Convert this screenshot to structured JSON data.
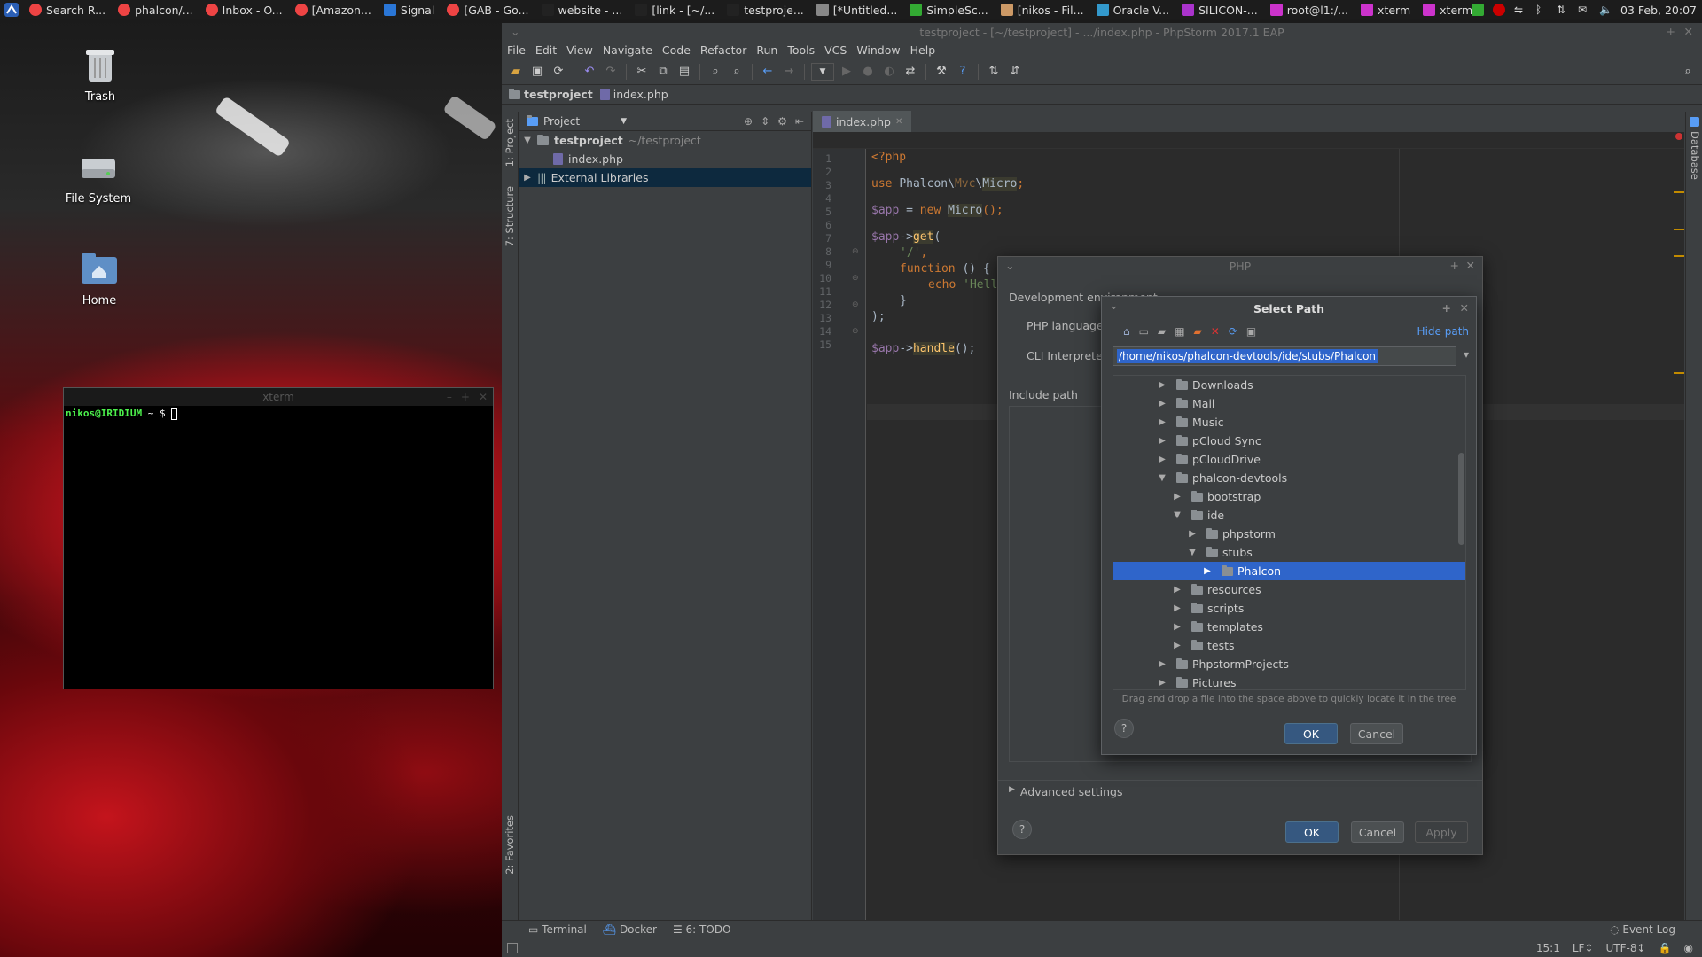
{
  "panel": {
    "tasks": [
      {
        "label": "Search R...",
        "icon": "chrome-icon",
        "color": "#e44"
      },
      {
        "label": "phalcon/...",
        "icon": "chrome-icon",
        "color": "#e44"
      },
      {
        "label": "Inbox - O...",
        "icon": "chrome-icon",
        "color": "#e44"
      },
      {
        "label": "[Amazon...",
        "icon": "chrome-icon",
        "color": "#e44"
      },
      {
        "label": "Signal",
        "icon": "signal-icon",
        "color": "#2a76d6"
      },
      {
        "label": "[GAB - Go...",
        "icon": "chrome-icon",
        "color": "#e44"
      },
      {
        "label": "website - ...",
        "icon": "phpstorm-icon",
        "color": "#222"
      },
      {
        "label": "[link - [~/...",
        "icon": "phpstorm-icon",
        "color": "#222"
      },
      {
        "label": "testproje...",
        "icon": "phpstorm-icon",
        "color": "#222"
      },
      {
        "label": "[*Untitled...",
        "icon": "editor-icon",
        "color": "#888"
      },
      {
        "label": "SimpleSc...",
        "icon": "screenshot-icon",
        "color": "#3a3"
      },
      {
        "label": "[nikos - Fil...",
        "icon": "home-folder-icon",
        "color": "#c96"
      },
      {
        "label": "Oracle V...",
        "icon": "virtualbox-icon",
        "color": "#39c"
      },
      {
        "label": "SILICON-...",
        "icon": "app-icon",
        "color": "#a3c"
      },
      {
        "label": "root@l1:/...",
        "icon": "xterm-icon",
        "color": "#c3c"
      },
      {
        "label": "xterm",
        "icon": "xterm-icon",
        "color": "#c3c"
      },
      {
        "label": "xterm",
        "icon": "xterm-icon",
        "color": "#c3c"
      }
    ],
    "clock": "03 Feb, 20:07"
  },
  "desktop": {
    "icons": [
      {
        "label": "Trash",
        "icon": "trash-icon"
      },
      {
        "label": "File System",
        "icon": "drive-icon"
      },
      {
        "label": "Home",
        "icon": "home-folder-icon"
      }
    ]
  },
  "xterm": {
    "title": "xterm",
    "prompt_user": "nikos@IRIDIUM",
    "prompt_rest": " ~ $ "
  },
  "ide": {
    "title": "testproject - [~/testproject] - .../index.php - PhpStorm 2017.1 EAP",
    "menu": [
      "File",
      "Edit",
      "View",
      "Navigate",
      "Code",
      "Refactor",
      "Run",
      "Tools",
      "VCS",
      "Window",
      "Help"
    ],
    "breadcrumb": [
      "testproject",
      "index.php"
    ],
    "left_tabs": [
      "1: Project",
      "7: Structure",
      "2: Favorites"
    ],
    "right_tabs": [
      "Database"
    ],
    "project_pane": {
      "header": "Project",
      "root_name": "testproject",
      "root_path": "~/testproject",
      "file": "index.php",
      "external": "External Libraries"
    },
    "editor_tab": "index.php",
    "line_numbers": [
      "1",
      "2",
      "3",
      "4",
      "5",
      "6",
      "7",
      "8",
      "9",
      "10",
      "11",
      "12",
      "13",
      "14",
      "15"
    ],
    "code": {
      "l1": "<?php",
      "l3_use": "use ",
      "l3_ns1": "Phalcon",
      "l3_sep": "\\",
      "l3_ns2": "Mvc",
      "l3_cls": "Micro",
      "l3_end": ";",
      "l5_var": "$app",
      "l5_eq": " = ",
      "l5_new": "new ",
      "l5_cls": "Micro",
      "l5_end": "();",
      "l7_var": "$app",
      "l7_arrow": "->",
      "l7_fn": "get",
      "l7_paren": "(",
      "l8_str": "'/'",
      "l8_comma": ",",
      "l9_kw": "function",
      "l9_rest": " () {",
      "l10_kw": "echo",
      "l10_str": " 'Hell",
      "l11": "}",
      "l12": ");",
      "l14_var": "$app",
      "l14_arrow": "->",
      "l14_fn": "handle",
      "l14_end": "();"
    },
    "bottom_tools": [
      "Terminal",
      "Docker",
      "6: TODO"
    ],
    "event_log": "Event Log",
    "status": {
      "position": "15:1",
      "line_sep": "LF↕",
      "encoding": "UTF-8↕"
    }
  },
  "php_dialog": {
    "title": "PHP",
    "dev_env": "Development environment",
    "php_lang": "PHP language l",
    "cli": "CLI Interpreter",
    "include_path": "Include path",
    "advanced": "Advanced settings",
    "ok": "OK",
    "cancel": "Cancel",
    "apply": "Apply",
    "help": "?"
  },
  "select_path": {
    "title": "Select Path",
    "hide_path": "Hide path",
    "path_value": "/home/nikos/phalcon-devtools/ide/stubs/Phalcon",
    "tree": [
      {
        "label": "Downloads",
        "depth": 0,
        "state": "collapsed"
      },
      {
        "label": "Mail",
        "depth": 0,
        "state": "collapsed"
      },
      {
        "label": "Music",
        "depth": 0,
        "state": "collapsed"
      },
      {
        "label": "pCloud Sync",
        "depth": 0,
        "state": "collapsed"
      },
      {
        "label": "pCloudDrive",
        "depth": 0,
        "state": "collapsed"
      },
      {
        "label": "phalcon-devtools",
        "depth": 0,
        "state": "expanded"
      },
      {
        "label": "bootstrap",
        "depth": 1,
        "state": "collapsed"
      },
      {
        "label": "ide",
        "depth": 1,
        "state": "expanded"
      },
      {
        "label": "phpstorm",
        "depth": 2,
        "state": "collapsed"
      },
      {
        "label": "stubs",
        "depth": 2,
        "state": "expanded"
      },
      {
        "label": "Phalcon",
        "depth": 3,
        "state": "collapsed",
        "selected": true
      },
      {
        "label": "resources",
        "depth": 1,
        "state": "collapsed"
      },
      {
        "label": "scripts",
        "depth": 1,
        "state": "collapsed"
      },
      {
        "label": "templates",
        "depth": 1,
        "state": "collapsed"
      },
      {
        "label": "tests",
        "depth": 1,
        "state": "collapsed"
      },
      {
        "label": "PhpstormProjects",
        "depth": 0,
        "state": "collapsed"
      },
      {
        "label": "Pictures",
        "depth": 0,
        "state": "collapsed"
      }
    ],
    "hint": "Drag and drop a file into the space above to quickly locate it in the tree",
    "ok": "OK",
    "cancel": "Cancel",
    "help": "?"
  },
  "colors": {
    "accent_blue": "#2f65ca",
    "ide_bg": "#3c3f41",
    "editor_bg": "#2b2b2b",
    "keyword": "#cc7832",
    "variable": "#9876aa",
    "string": "#6a8759",
    "function": "#ffc66d"
  }
}
